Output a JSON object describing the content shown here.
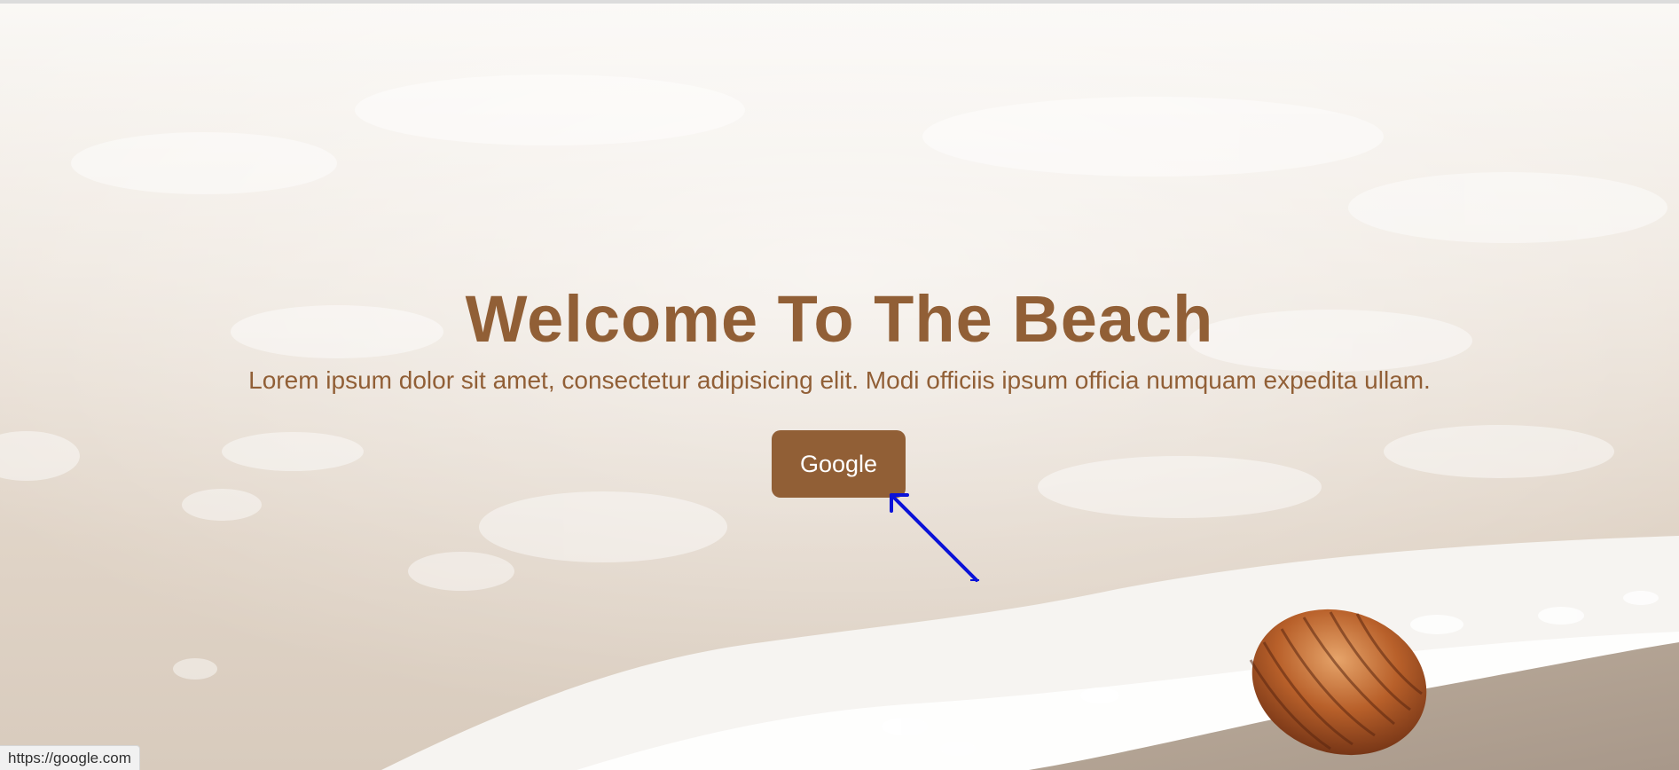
{
  "hero": {
    "title": "Welcome To The Beach",
    "subtitle": "Lorem ipsum dolor sit amet, consectetur adipisicing elit. Modi officiis ipsum officia numquam expedita ullam.",
    "button_label": "Google"
  },
  "status_bar": {
    "url": "https://google.com"
  },
  "colors": {
    "accent": "#915f36",
    "button_text": "#ffffff",
    "pointer_arrow": "#0a12d8"
  },
  "icons": {
    "pointer": "arrow-pointer-icon",
    "seashell": "seashell-icon"
  }
}
